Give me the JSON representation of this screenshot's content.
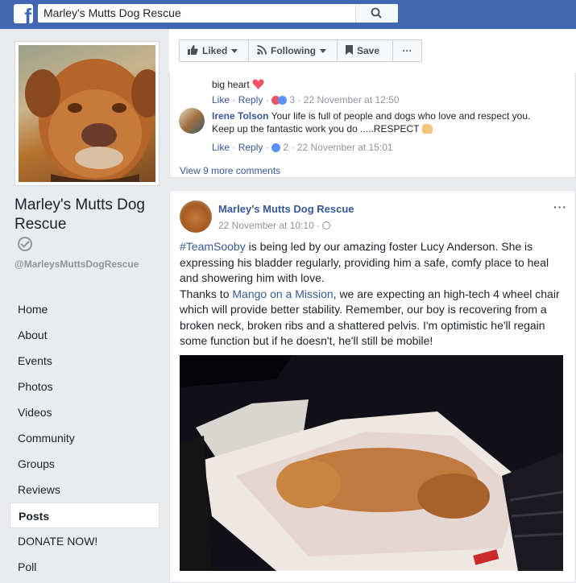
{
  "topbar": {
    "logo": "f",
    "search_value": "Marley's Mutts Dog Rescue",
    "search_icon": "search-icon"
  },
  "sidebar": {
    "page_name": "Marley's Mutts Dog Rescue",
    "handle": "@MarleysMuttsDogRescue",
    "nav": [
      "Home",
      "About",
      "Events",
      "Photos",
      "Videos",
      "Community",
      "Groups",
      "Reviews",
      "Posts",
      "DONATE NOW!",
      "Poll"
    ],
    "active": "Posts"
  },
  "actions": {
    "liked": "Liked",
    "following": "Following",
    "save": "Save",
    "more": "···"
  },
  "comments": {
    "prev_comment_tail": "big heart",
    "prev_like": "Like",
    "prev_reply": "Reply",
    "prev_count": "3",
    "prev_time": "22 November at 12:50",
    "author": "Irene Tolson",
    "text_line1": "Your life is full of people and dogs who love and respect you.",
    "text_line2": "Keep up the fantastic work you do .....RESPECT",
    "like": "Like",
    "reply": "Reply",
    "count": "2",
    "time": "22 November at 15:01",
    "view_more": "View 9 more comments",
    "sep": "·"
  },
  "post": {
    "author": "Marley's Mutts Dog Rescue",
    "time": "22 November at 10:10",
    "sep": "·",
    "menu": "···",
    "hashtag": "#TeamSooby",
    "line1_rest": " is being led by our amazing foster Lucy Anderson. She is expressing his bladder regularly, providing him a safe, comfy place to heal and showering him with love.",
    "line2_pre": "Thanks to ",
    "mention": "Mango on a Mission",
    "line2_rest": ", we are expecting an high-tech 4 wheel chair which will provide better stability. Remember, our boy is recovering from a broken neck, broken ribs and a shattered pelvis. I'm optimistic he'll regain some function but if he doesn't, he'll still be mobile!"
  },
  "colors": {
    "brand": "#4267b2",
    "link": "#385898",
    "meta": "#90949c",
    "love": "#f25268",
    "like": "#5890ff"
  }
}
